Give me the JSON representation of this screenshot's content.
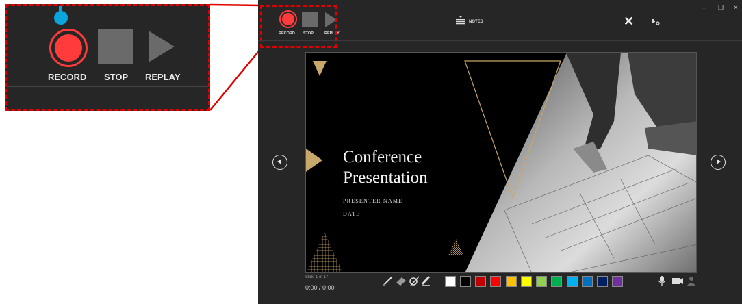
{
  "zoom": {
    "record_label": "RECORD",
    "stop_label": "STOP",
    "replay_label": "REPLAY"
  },
  "toolbar": {
    "record_label": "RECORD",
    "stop_label": "STOP",
    "replay_label": "REPLAY",
    "notes_label": "NOTES",
    "close_glyph": "✕",
    "minimize_glyph": "–",
    "restore_glyph": "❐",
    "window_close_glyph": "✕"
  },
  "slide": {
    "title_line1": "Conference",
    "title_line2": "Presentation",
    "presenter": "PRESENTER NAME",
    "date": "DATE"
  },
  "status": {
    "slide_counter": "Slide 1 of 17",
    "timer": "0:00 / 0:00"
  },
  "colors": {
    "record_red": "#ff3b3b",
    "highlight_red": "#e00000",
    "pointer_blue": "#0aa5dc",
    "gold": "#c8a76a",
    "swatches": [
      "#ffffff",
      "#000000",
      "#c00000",
      "#ff0000",
      "#ffc000",
      "#ffff00",
      "#92d050",
      "#00b050",
      "#00b0f0",
      "#0070c0",
      "#002060",
      "#7030a0"
    ]
  },
  "icons": [
    "record-icon",
    "stop-icon",
    "replay-icon",
    "notes-icon",
    "close-icon",
    "more-options-icon",
    "prev-slide-icon",
    "next-slide-icon",
    "pen-icon",
    "eraser-icon",
    "highlighter-icon",
    "microphone-icon",
    "camera-icon",
    "camera-preview-icon"
  ]
}
